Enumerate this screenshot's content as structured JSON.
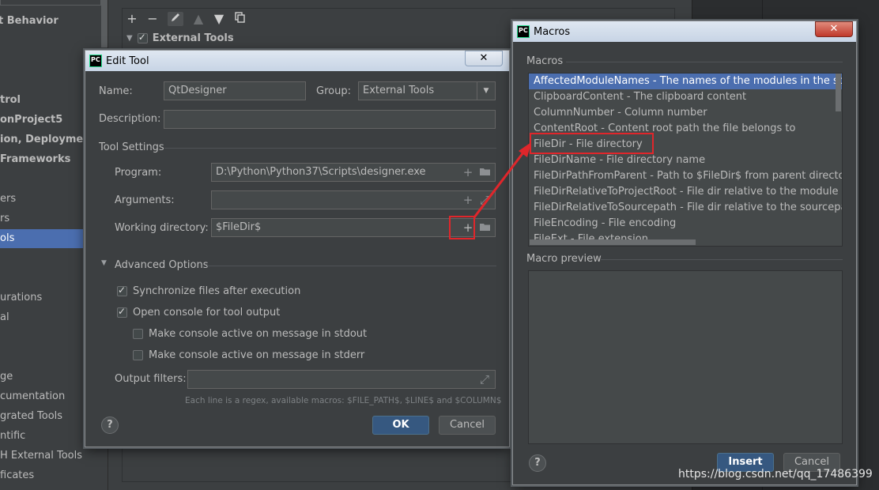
{
  "settings_sidebar": {
    "items": [
      {
        "label": "t Behavior",
        "bold": true,
        "selected": false
      },
      {
        "label": "trol",
        "bold": true,
        "selected": false
      },
      {
        "label": "onProject5",
        "bold": true,
        "selected": false
      },
      {
        "label": "ion, Deployment",
        "bold": true,
        "selected": false
      },
      {
        "label": "Frameworks",
        "bold": true,
        "selected": false
      },
      {
        "label": "ers",
        "bold": false,
        "selected": false
      },
      {
        "label": "rs",
        "bold": false,
        "selected": false
      },
      {
        "label": "ols",
        "bold": false,
        "selected": true
      },
      {
        "label": "urations",
        "bold": false,
        "selected": false
      },
      {
        "label": "al",
        "bold": false,
        "selected": false
      },
      {
        "label": "ge",
        "bold": false,
        "selected": false
      },
      {
        "label": "cumentation",
        "bold": false,
        "selected": false
      },
      {
        "label": "grated Tools",
        "bold": false,
        "selected": false
      },
      {
        "label": "ntific",
        "bold": false,
        "selected": false
      },
      {
        "label": "H External Tools",
        "bold": false,
        "selected": false
      },
      {
        "label": "ficates",
        "bold": false,
        "selected": false
      }
    ]
  },
  "external_tools": {
    "group_label": "External Tools"
  },
  "edit_tool": {
    "title": "Edit Tool",
    "close_symbol": "✕",
    "name_label": "Name:",
    "name_value": "QtDesigner",
    "group_label": "Group:",
    "group_value": "External Tools",
    "description_label": "Description:",
    "description_value": "",
    "tool_settings_label": "Tool Settings",
    "program_label": "Program:",
    "program_value": "D:\\Python\\Python37\\Scripts\\designer.exe",
    "arguments_label": "Arguments:",
    "arguments_value": "",
    "working_dir_label": "Working directory:",
    "working_dir_value": "$FileDir$",
    "advanced_label": "Advanced Options",
    "options": [
      {
        "label": "Synchronize files after execution",
        "checked": true
      },
      {
        "label": "Open console for tool output",
        "checked": true
      },
      {
        "label": "Make console active on message in stdout",
        "checked": false
      },
      {
        "label": "Make console active on message in stderr",
        "checked": false
      }
    ],
    "output_filters_label": "Output filters:",
    "output_filters_value": "",
    "hint": "Each line is a regex, available macros: $FILE_PATH$, $LINE$ and $COLUMN$",
    "ok_label": "OK",
    "cancel_label": "Cancel",
    "help_label": "?"
  },
  "macros_dialog": {
    "title": "Macros",
    "close_symbol": "✕",
    "macros_label": "Macros",
    "items": [
      {
        "text": "AffectedModuleNames - The names of the modules in the scope, c",
        "selected": true
      },
      {
        "text": "ClipboardContent - The clipboard content",
        "selected": false
      },
      {
        "text": "ColumnNumber - Column number",
        "selected": false
      },
      {
        "text": "ContentRoot - Content root path the file belongs to",
        "selected": false
      },
      {
        "text": "FileDir - File directory",
        "selected": false
      },
      {
        "text": "FileDirName - File directory name",
        "selected": false
      },
      {
        "text": "FileDirPathFromParent - Path to $FileDir$ from parent directory with",
        "selected": false
      },
      {
        "text": "FileDirRelativeToProjectRoot - File dir relative to the module conten",
        "selected": false
      },
      {
        "text": "FileDirRelativeToSourcepath - File dir relative to the sourcepath roo",
        "selected": false
      },
      {
        "text": "FileEncoding - File encoding",
        "selected": false
      },
      {
        "text": "FileExt - File extension",
        "selected": false
      }
    ],
    "preview_label": "Macro preview",
    "insert_label": "Insert",
    "cancel_label": "Cancel",
    "help_label": "?"
  },
  "watermark": "https://blog.csdn.net/qq_17486399",
  "colors": {
    "accent_selection": "#4b6eaf",
    "annotation_red": "#e0262b",
    "primary_button": "#365880"
  }
}
